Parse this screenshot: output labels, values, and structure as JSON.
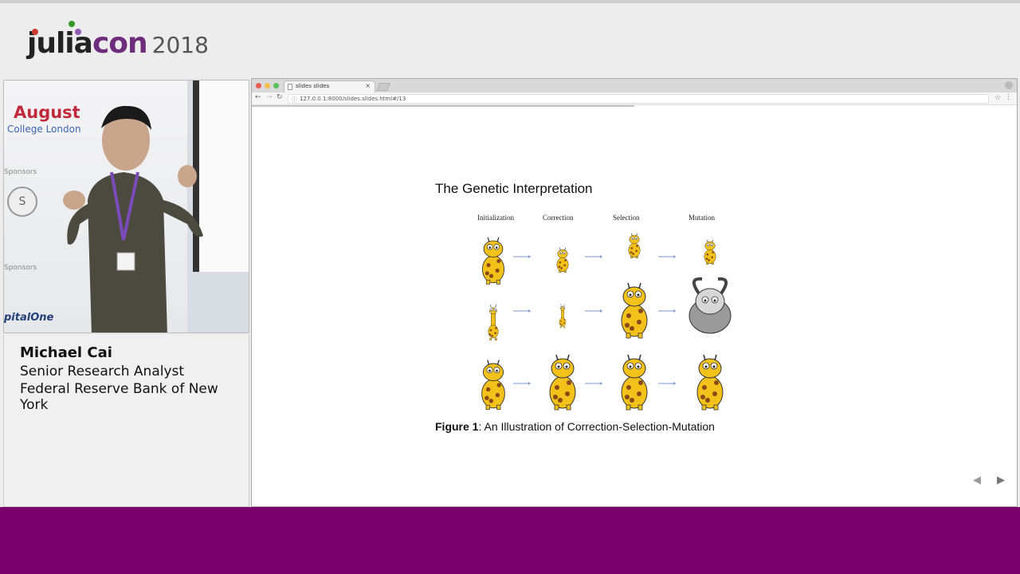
{
  "header": {
    "logo_julia": "julia",
    "logo_con": "con",
    "logo_year": "2018"
  },
  "camera": {
    "banner_month": "August",
    "banner_place": "College London",
    "sponsors_label_1": "Sponsors",
    "sponsors_label_2": "Sponsors",
    "sponsor_logo": "pitalOne"
  },
  "speaker": {
    "name": "Michael Cai",
    "title": "Senior Research Analyst",
    "organization": "Federal Reserve Bank of New York"
  },
  "browser": {
    "tab_title": "slides slides",
    "url": "127.0.0.1:8000/slides.slides.html#/13",
    "close_glyph": "×",
    "back_glyph": "←",
    "forward_glyph": "→",
    "reload_glyph": "↻",
    "star_glyph": "☆",
    "menu_glyph": "⋮",
    "lock_glyph": "ⓘ"
  },
  "slide": {
    "title": "The Genetic Interpretation",
    "columns": [
      "Initialization",
      "Correction",
      "Selection",
      "Mutation"
    ],
    "caption_label": "Figure 1",
    "caption_text": ": An Illustration of Correction-Selection-Mutation",
    "nav_prev": "◀",
    "nav_next": "▶"
  },
  "colors": {
    "accent_purple": "#7a006e",
    "giraffe_yellow": "#f2c21a",
    "giraffe_spot": "#8a4a17"
  }
}
